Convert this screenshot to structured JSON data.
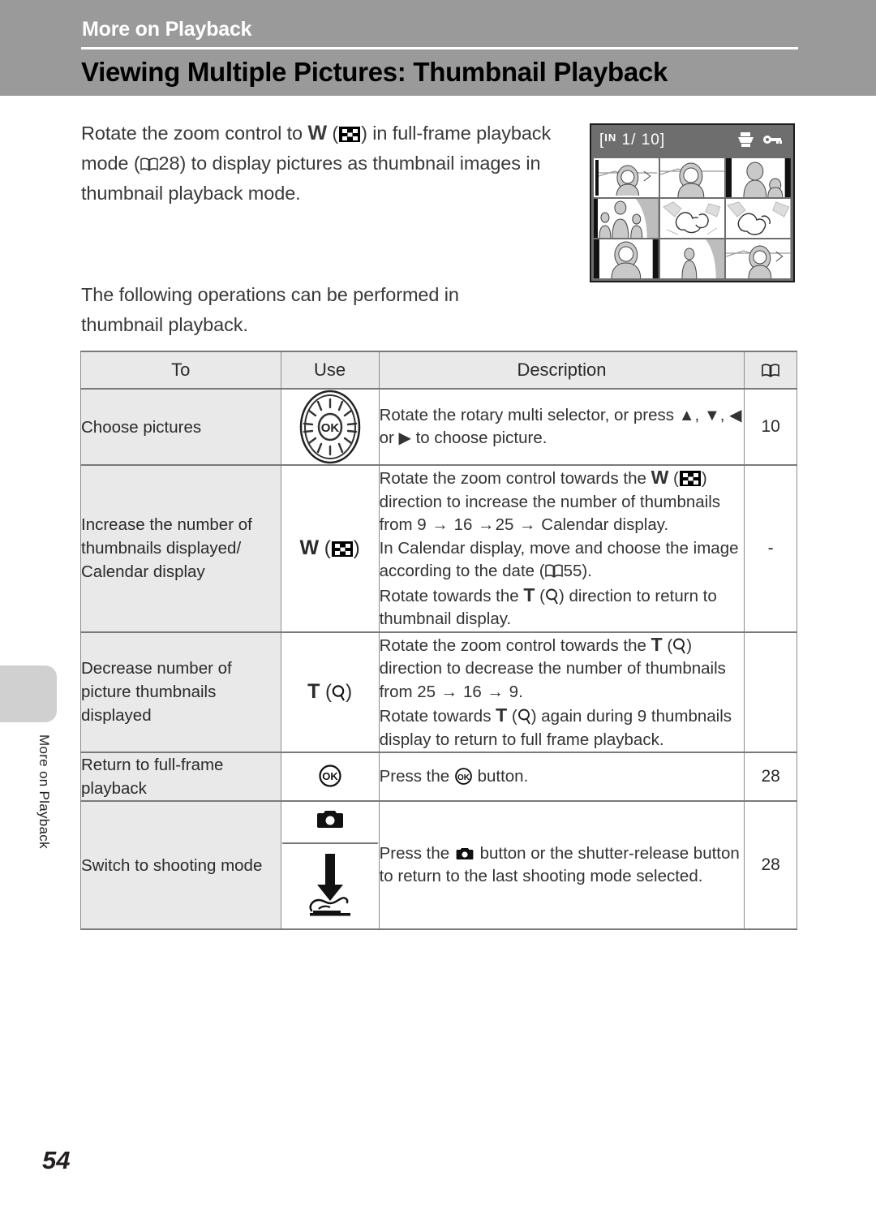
{
  "header": {
    "chapter": "More on Playback",
    "title": "Viewing Multiple Pictures: Thumbnail Playback"
  },
  "side_tab": {
    "label": "More on Playback"
  },
  "page_number": "54",
  "intro": {
    "p1_a": "Rotate the zoom control to ",
    "p1_w": "W",
    "p1_b": ") in full-frame playback mode (",
    "p1_page": "28",
    "p1_c": ") to display pictures as thumbnail images in thumbnail playback mode.",
    "p2": "The following operations can be performed in thumbnail playback."
  },
  "camera_screen": {
    "storage": "IN",
    "frame_current": "1/",
    "frame_total": "10",
    "bracket_open": "[",
    "bracket_close": "]",
    "icons": [
      "print-order-icon",
      "protect-key-icon"
    ],
    "thumbnail_count": 9,
    "selected_index": 0
  },
  "table": {
    "headers": {
      "to": "To",
      "use": "Use",
      "description": "Description",
      "ref": "book-icon"
    },
    "rows": [
      {
        "to": "Choose pictures",
        "use_icon": "rotary-multi-selector-dial",
        "use_label": "",
        "desc_a": "Rotate the rotary multi selector, or press ",
        "desc_b": ", ",
        "desc_c": ", ",
        "desc_d": " or ",
        "desc_e": " to choose picture.",
        "ref": "10"
      },
      {
        "to": "Increase the number of thumbnails displayed/ Calendar display",
        "use_label": "W",
        "use_icon": "thumbnail-icon",
        "desc_l1_a": "Rotate the zoom control towards the ",
        "desc_l1_w": "W",
        "desc_l1_b": ") direction to increase the number of thumbnails from 9 ",
        "desc_l1_c": " 16 ",
        "desc_l1_d": "25 ",
        "desc_l1_e": " Calendar display.",
        "desc_l2_a": "In Calendar display, move and choose the image according to the date (",
        "desc_l2_page": "55",
        "desc_l2_b": ").",
        "desc_l3_a": "Rotate towards the ",
        "desc_l3_t": "T",
        "desc_l3_b": ") direction to return to thumbnail display.",
        "ref": "-"
      },
      {
        "to": "Decrease number of picture thumbnails displayed",
        "use_label": "T",
        "use_icon": "magnifier-icon",
        "desc_l1_a": "Rotate the zoom control towards the ",
        "desc_l1_t": "T",
        "desc_l1_b": ") direction to decrease the number of thumbnails from 25 ",
        "desc_l1_c": " 16 ",
        "desc_l1_d": " 9.",
        "desc_l2_a": "Rotate towards ",
        "desc_l2_t": "T",
        "desc_l2_b": ") again during 9 thumbnails display to return to full frame playback.",
        "ref": ""
      },
      {
        "to": "Return to full-frame playback",
        "use_icon": "ok-button-icon",
        "desc_a": "Press the ",
        "desc_b": " button.",
        "ref": "28"
      },
      {
        "to": "Switch to shooting mode",
        "use_icon_top": "camera-mode-icon",
        "use_icon_bottom": "shutter-release-press-icon",
        "desc_a": "Press the ",
        "desc_b": " button or the shutter-release button to return to the last shooting mode selected.",
        "ref": "28"
      }
    ]
  },
  "colors": {
    "header_band": "#9a9a9a",
    "table_header_bg": "#e9e9e9",
    "first_column_bg": "#e9e9e9",
    "screen_bg": "#6e6e6e",
    "side_tab": "#d0d0d0"
  }
}
